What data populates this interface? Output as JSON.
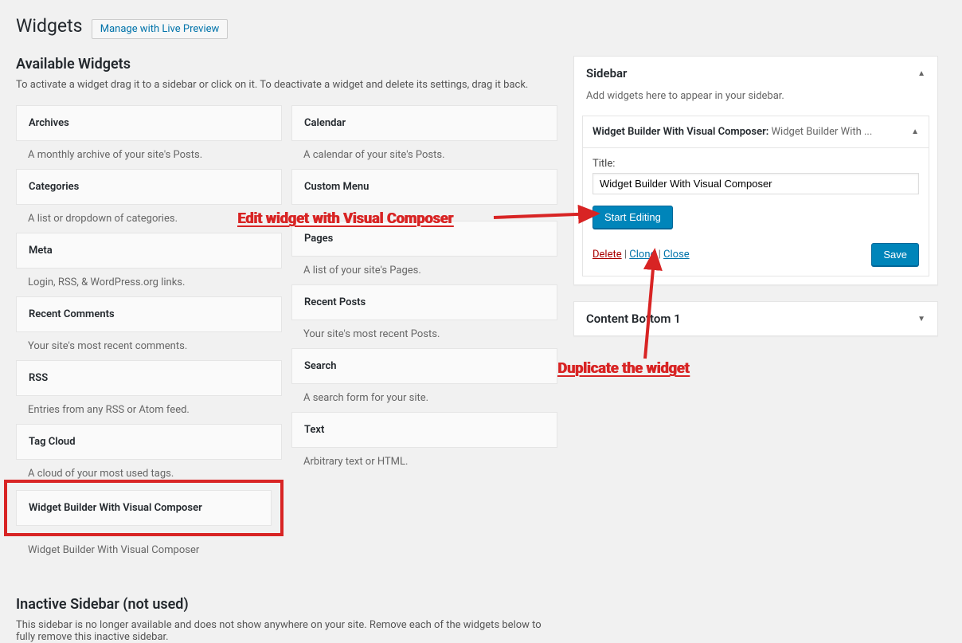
{
  "page": {
    "title": "Widgets",
    "manage_preview_label": "Manage with Live Preview",
    "available_heading": "Available Widgets",
    "available_desc": "To activate a widget drag it to a sidebar or click on it. To deactivate a widget and delete its settings, drag it back.",
    "inactive_heading": "Inactive Sidebar (not used)",
    "inactive_desc": "This sidebar is no longer available and does not show anywhere on your site. Remove each of the widgets below to fully remove this inactive sidebar."
  },
  "widgets_left": [
    {
      "title": "Archives",
      "desc": "A monthly archive of your site's Posts."
    },
    {
      "title": "Categories",
      "desc": "A list or dropdown of categories."
    },
    {
      "title": "Meta",
      "desc": "Login, RSS, & WordPress.org links."
    },
    {
      "title": "Recent Comments",
      "desc": "Your site's most recent comments."
    },
    {
      "title": "RSS",
      "desc": "Entries from any RSS or Atom feed."
    },
    {
      "title": "Tag Cloud",
      "desc": "A cloud of your most used tags."
    },
    {
      "title": "Widget Builder With Visual Composer",
      "desc": "Widget Builder With Visual Composer"
    }
  ],
  "widgets_right": [
    {
      "title": "Calendar",
      "desc": "A calendar of your site's Posts."
    },
    {
      "title": "Custom Menu",
      "desc": ""
    },
    {
      "title": "Pages",
      "desc": "A list of your site's Pages."
    },
    {
      "title": "Recent Posts",
      "desc": "Your site's most recent Posts."
    },
    {
      "title": "Search",
      "desc": "A search form for your site."
    },
    {
      "title": "Text",
      "desc": "Arbitrary text or HTML."
    }
  ],
  "sidebar_panel": {
    "title": "Sidebar",
    "desc": "Add widgets here to appear in your sidebar."
  },
  "active_widget": {
    "header_prefix": "Widget Builder With Visual Composer:",
    "header_instance": " Widget Builder With ...",
    "title_label": "Title:",
    "title_value": "Widget Builder With Visual Composer",
    "start_editing_label": "Start Editing",
    "delete_label": "Delete",
    "clone_label": "Clone",
    "close_label": "Close",
    "save_label": "Save"
  },
  "bottom_panel": {
    "title": "Content Bottom 1"
  },
  "annot": {
    "edit": "Edit widget with Visual Composer",
    "duplicate": "Duplicate the widget"
  }
}
